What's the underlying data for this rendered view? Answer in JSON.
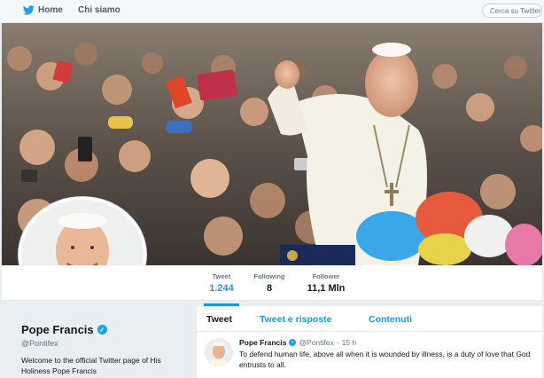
{
  "nav": {
    "home_label": "Home",
    "about_label": "Chi siamo",
    "search_placeholder": "Cerca su Twitter",
    "brand_color": "#1da1f2"
  },
  "profile": {
    "name": "Pope Francis",
    "handle": "@Pontifex",
    "bio": "Welcome to the official Twitter page of His Holiness Pope Francis"
  },
  "stats": [
    {
      "label": "Tweet",
      "value": "1.244"
    },
    {
      "label": "Following",
      "value": "8"
    },
    {
      "label": "Follower",
      "value": "11,1 Mln"
    }
  ],
  "timeline": {
    "tabs": [
      {
        "label": "Tweet",
        "active": true
      },
      {
        "label": "Tweet e risposte",
        "active": false
      },
      {
        "label": "Contenuti",
        "active": false
      }
    ],
    "tweet": {
      "name": "Pope Francis",
      "handle": "@Pontifex",
      "time": "15 h",
      "text": "To defend human life, above all when it is wounded by illness, is a duty of love that God entrusts to all."
    }
  }
}
